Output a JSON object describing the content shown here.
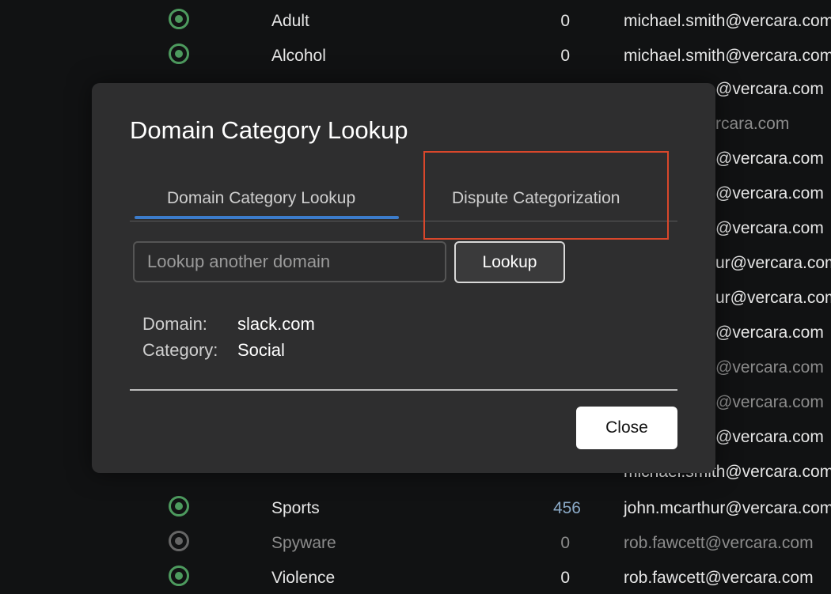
{
  "background_table": {
    "rows": [
      {
        "status": "enabled",
        "category": "Adult",
        "count": "0",
        "email": "michael.smith@vercara.com"
      },
      {
        "status": "enabled",
        "category": "Alcohol",
        "count": "0",
        "email": "michael.smith@vercara.com"
      },
      {
        "status": "enabled",
        "category": "Sports",
        "count": "456",
        "email": "john.mcarthur@vercara.com"
      },
      {
        "status": "disabled",
        "category": "Spyware",
        "count": "0",
        "email": "rob.fawcett@vercara.com"
      },
      {
        "status": "enabled",
        "category": "Violence",
        "count": "0",
        "email": "rob.fawcett@vercara.com"
      }
    ],
    "partial_emails": [
      "@vercara.com",
      "rcara.com",
      "@vercara.com",
      "@vercara.com",
      "@vercara.com",
      "ur@vercara.com",
      "ur@vercara.com",
      "@vercara.com",
      "@vercara.com",
      "@vercara.com",
      "@vercara.com",
      "michael.smith@vercara.com"
    ]
  },
  "modal": {
    "title": "Domain Category Lookup",
    "tabs": [
      {
        "label": "Domain Category Lookup",
        "active": true
      },
      {
        "label": "Dispute Categorization",
        "active": false
      }
    ],
    "lookup_input": {
      "value": "",
      "placeholder": "Lookup another domain"
    },
    "lookup_button_label": "Lookup",
    "result": {
      "domain_label": "Domain:",
      "domain_value": "slack.com",
      "category_label": "Category:",
      "category_value": "Social"
    },
    "close_button_label": "Close"
  },
  "colors": {
    "accent_tab": "#3c7ccb",
    "highlight_box": "#d9472b",
    "enabled_radio": "#4d9a5e",
    "modal_bg": "#2e2e2f",
    "page_bg": "#111213"
  }
}
